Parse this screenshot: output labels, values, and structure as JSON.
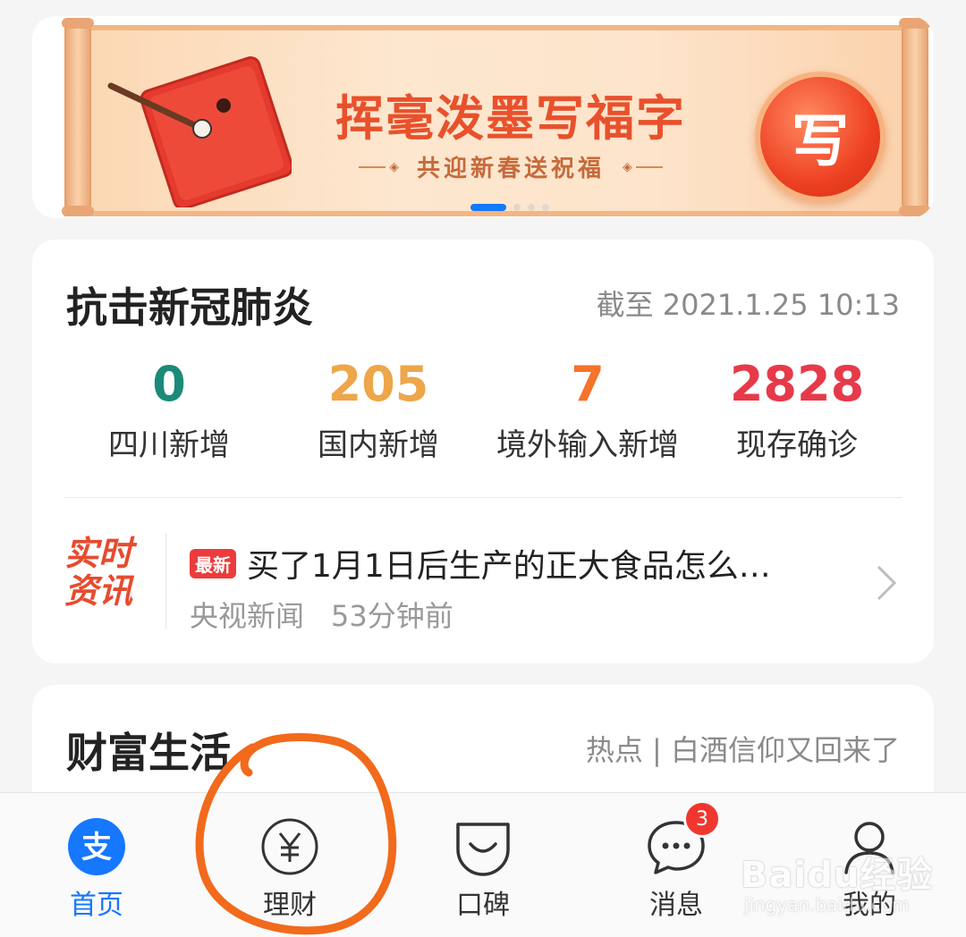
{
  "banner": {
    "title": "挥毫泼墨写福字",
    "subtitle": "共迎新春送祝福",
    "button_label": "写",
    "carousel_count": 4,
    "carousel_active": 0
  },
  "covid": {
    "title": "抗击新冠肺炎",
    "timestamp": "截至 2021.1.25 10:13",
    "stats": [
      {
        "value": "0",
        "label": "四川新增",
        "color": "#1b8a78"
      },
      {
        "value": "205",
        "label": "国内新增",
        "color": "#eea64a"
      },
      {
        "value": "7",
        "label": "境外输入新增",
        "color": "#f5732a"
      },
      {
        "value": "2828",
        "label": "现存确诊",
        "color": "#e63a4a"
      }
    ],
    "news": {
      "logo_line1": "实时",
      "logo_line2": "资讯",
      "badge": "最新",
      "headline": "买了1月1日后生产的正大食品怎么…",
      "source": "央视新闻",
      "time": "53分钟前"
    }
  },
  "wealth": {
    "title": "财富生活",
    "hot": "热点 | 白酒信仰又回来了"
  },
  "tabbar": {
    "tabs": [
      {
        "label": "首页",
        "icon": "alipay-logo-icon",
        "active": true
      },
      {
        "label": "理财",
        "icon": "yuan-coin-icon",
        "active": false
      },
      {
        "label": "口碑",
        "icon": "smile-bag-icon",
        "active": false
      },
      {
        "label": "消息",
        "icon": "chat-bubble-icon",
        "active": false,
        "badge": "3"
      },
      {
        "label": "我的",
        "icon": "user-icon",
        "active": false
      }
    ]
  },
  "watermark": {
    "brand": "Baidu经验",
    "url": "jingyan.baidu.com"
  },
  "colors": {
    "accent": "#1677ff",
    "annotation": "#f26a1b"
  }
}
